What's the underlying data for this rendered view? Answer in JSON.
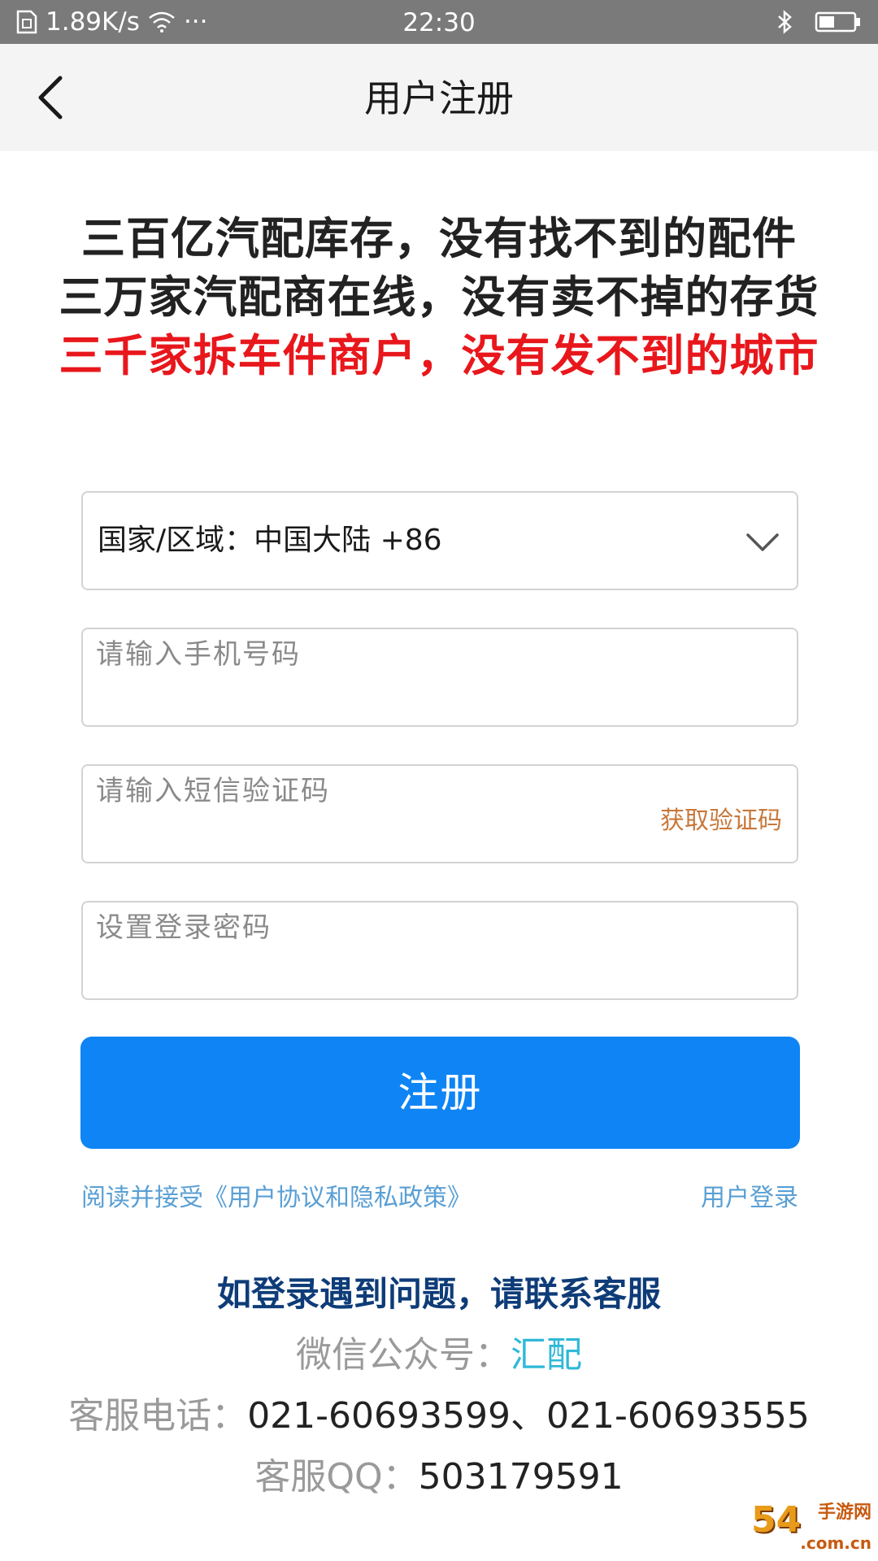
{
  "status_bar": {
    "network_speed": "1.89K/s",
    "more": "···",
    "time": "22:30",
    "icons": [
      "sim-icon",
      "wifi-icon",
      "bluetooth-icon",
      "battery-icon"
    ]
  },
  "nav": {
    "title": "用户注册",
    "back_icon": "chevron-left-icon"
  },
  "slogan": {
    "line1": "三百亿汽配库存，没有找不到的配件",
    "line2": "三万家汽配商在线，没有卖不掉的存货",
    "line3": "三千家拆车件商户，没有发不到的城市",
    "line3_color": "#e8171c"
  },
  "form": {
    "country_text": "国家/区域：中国大陆 +86",
    "phone_placeholder": "请输入手机号码",
    "sms_placeholder": "请输入短信验证码",
    "get_code_label": "获取验证码",
    "password_placeholder": "设置登录密码",
    "register_label": "注册"
  },
  "links": {
    "agreement": "阅读并接受《用户协议和隐私政策》",
    "login": "用户登录"
  },
  "contact": {
    "heading": "如登录遇到问题，请联系客服",
    "wechat_label": "微信公众号：",
    "wechat_value": "汇配",
    "phone_label": "客服电话：",
    "phone_value": "021-60693599、021-60693555",
    "qq_label": "客服QQ：",
    "qq_value": "503179591"
  },
  "watermark": {
    "number": "54",
    "small": "手游网",
    "domain": ".com.cn"
  },
  "colors": {
    "accent": "#0e84f5",
    "link": "#5a9fd4",
    "get_code": "#c8783a",
    "heading": "#0e3c78"
  }
}
